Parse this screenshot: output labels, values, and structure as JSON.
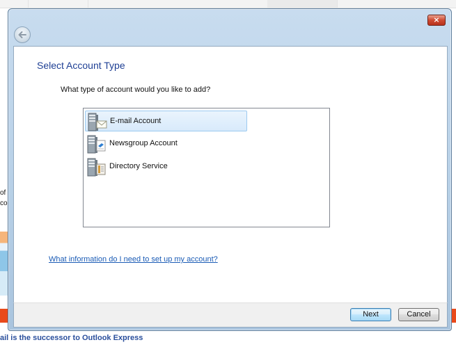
{
  "background": {
    "left_fragment_1": "of",
    "left_fragment_2": "co",
    "bottom_banner": "ail is the successor to Outlook Express"
  },
  "dialog": {
    "close_glyph": "×",
    "title": "Select Account Type",
    "question": "What type of account would you like to add?",
    "account_types": [
      {
        "label": "E-mail Account",
        "icon": "email-server-icon",
        "selected": true
      },
      {
        "label": "Newsgroup Account",
        "icon": "newsgroup-server-icon",
        "selected": false
      },
      {
        "label": "Directory Service",
        "icon": "directory-server-icon",
        "selected": false
      }
    ],
    "help_link": "What information do I need to set up my account?",
    "buttons": {
      "next": "Next",
      "cancel": "Cancel"
    }
  },
  "colors": {
    "title": "#1e3f94",
    "link": "#1a5bb5",
    "selection": "#d8eafb",
    "close_button": "#cf4b32"
  }
}
